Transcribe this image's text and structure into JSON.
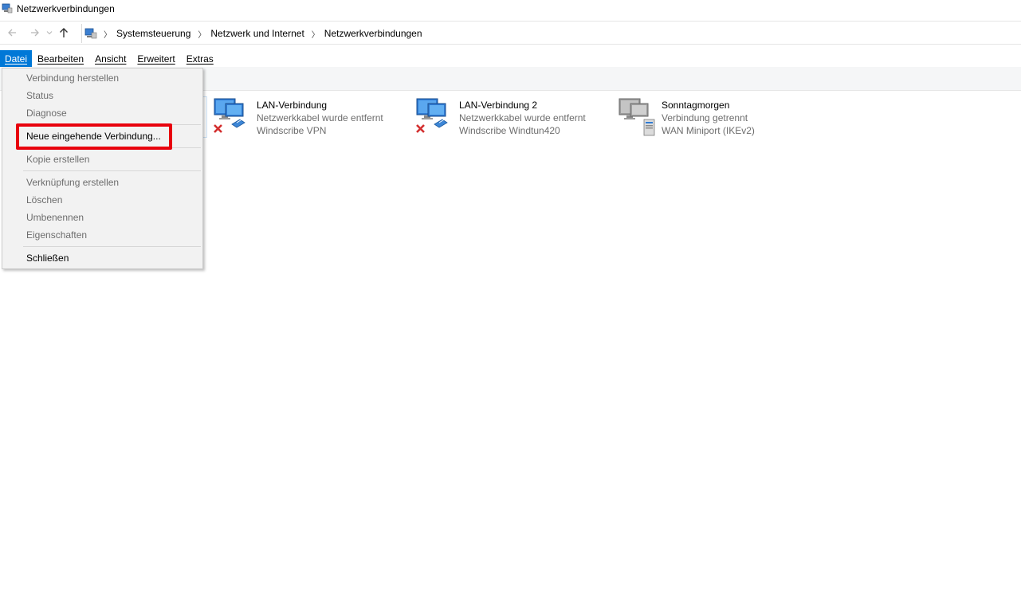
{
  "window": {
    "title": "Netzwerkverbindungen"
  },
  "nav": {
    "back_icon": "arrow-left-icon",
    "forward_icon": "arrow-right-icon",
    "recent_icon": "chevron-down-icon",
    "up_icon": "arrow-up-icon",
    "breadcrumbs": [
      "Systemsteuerung",
      "Netzwerk und Internet",
      "Netzwerkverbindungen"
    ]
  },
  "menubar": {
    "items": [
      "Datei",
      "Bearbeiten",
      "Ansicht",
      "Erweitert",
      "Extras"
    ],
    "active": "Datei"
  },
  "file_menu": {
    "items": [
      {
        "label": "Verbindung herstellen",
        "enabled": false
      },
      {
        "label": "Status",
        "enabled": false
      },
      {
        "label": "Diagnose",
        "enabled": false
      },
      {
        "label": "Neue eingehende Verbindung...",
        "enabled": true
      },
      {
        "label": "Kopie erstellen",
        "enabled": false
      },
      {
        "label": "Verknüpfung erstellen",
        "enabled": false
      },
      {
        "label": "Löschen",
        "enabled": false
      },
      {
        "label": "Umbenennen",
        "enabled": false
      },
      {
        "label": "Eigenschaften",
        "enabled": false
      },
      {
        "label": "Schließen",
        "enabled": true
      }
    ],
    "highlight_color": "#e8000d"
  },
  "connections": [
    {
      "name": "LAN-Verbindung",
      "status": "Netzwerkkabel wurde entfernt",
      "device": "Windscribe VPN",
      "icon": "ethernet-disconnected-icon"
    },
    {
      "name": "LAN-Verbindung 2",
      "status": "Netzwerkkabel wurde entfernt",
      "device": "Windscribe Windtun420",
      "icon": "ethernet-disconnected-icon"
    },
    {
      "name": "Sonntagmorgen",
      "status": "Verbindung getrennt",
      "device": "WAN Miniport (IKEv2)",
      "icon": "vpn-connection-icon"
    }
  ],
  "colors": {
    "accent": "#0078d7",
    "disabled_text": "#6d6d6d",
    "error": "#d32f2f"
  }
}
